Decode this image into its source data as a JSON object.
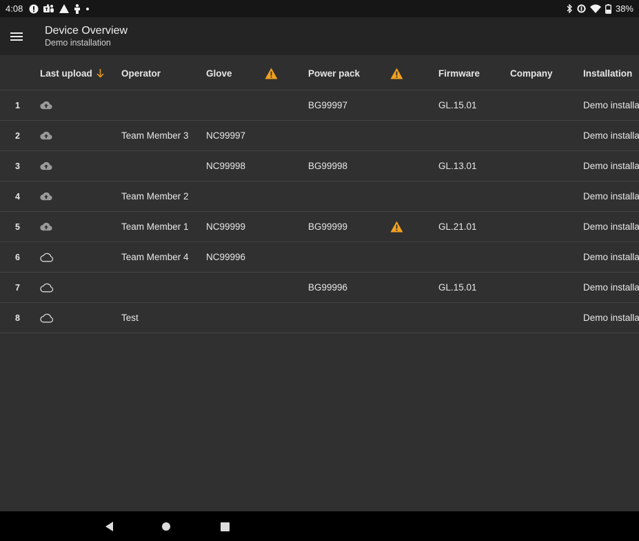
{
  "status_bar": {
    "time": "4:08",
    "battery": "38%",
    "left_icons": [
      "circle-info-icon",
      "teams-icon",
      "warning-icon",
      "person-icon",
      "dot-icon"
    ],
    "right_icons": [
      "bluetooth-icon",
      "data-saver-icon",
      "wifi-icon",
      "battery-icon"
    ]
  },
  "app_bar": {
    "title": "Device Overview",
    "subtitle": "Demo installation",
    "menu_icon": "menu-icon"
  },
  "table": {
    "headers": {
      "last_upload": "Last upload",
      "operator": "Operator",
      "glove": "Glove",
      "power_pack": "Power pack",
      "firmware": "Firmware",
      "company": "Company",
      "installation": "Installation"
    },
    "sort_icon": "arrow-down-icon",
    "rows": [
      {
        "num": "1",
        "upload": "cloud-upload-filled",
        "operator": "",
        "glove": "",
        "glove_warning": false,
        "power_pack": "BG99997",
        "power_warning": false,
        "firmware": "GL.15.01",
        "company": "",
        "installation": "Demo installat"
      },
      {
        "num": "2",
        "upload": "cloud-upload-filled",
        "operator": "Team Member 3",
        "glove": "NC99997",
        "glove_warning": false,
        "power_pack": "",
        "power_warning": false,
        "firmware": "",
        "company": "",
        "installation": "Demo installat"
      },
      {
        "num": "3",
        "upload": "cloud-upload-filled",
        "operator": "",
        "glove": "NC99998",
        "glove_warning": false,
        "power_pack": "BG99998",
        "power_warning": false,
        "firmware": "GL.13.01",
        "company": "",
        "installation": "Demo installat"
      },
      {
        "num": "4",
        "upload": "cloud-upload-filled",
        "operator": "Team Member 2",
        "glove": "",
        "glove_warning": false,
        "power_pack": "",
        "power_warning": false,
        "firmware": "",
        "company": "",
        "installation": "Demo installat"
      },
      {
        "num": "5",
        "upload": "cloud-upload-filled",
        "operator": "Team Member 1",
        "glove": "NC99999",
        "glove_warning": false,
        "power_pack": "BG99999",
        "power_warning": true,
        "firmware": "GL.21.01",
        "company": "",
        "installation": "Demo installat"
      },
      {
        "num": "6",
        "upload": "cloud-outline",
        "operator": "Team Member 4",
        "glove": "NC99996",
        "glove_warning": false,
        "power_pack": "",
        "power_warning": false,
        "firmware": "",
        "company": "",
        "installation": "Demo installat"
      },
      {
        "num": "7",
        "upload": "cloud-outline",
        "operator": "",
        "glove": "",
        "glove_warning": false,
        "power_pack": "BG99996",
        "power_warning": false,
        "firmware": "GL.15.01",
        "company": "",
        "installation": "Demo installat"
      },
      {
        "num": "8",
        "upload": "cloud-outline",
        "operator": "Test",
        "glove": "",
        "glove_warning": false,
        "power_pack": "",
        "power_warning": false,
        "firmware": "",
        "company": "",
        "installation": "Demo installat"
      }
    ]
  },
  "colors": {
    "warning": "#f0a020",
    "accent": "#f0a020",
    "background": "#303030",
    "app_bar": "#242424"
  },
  "nav_bar": {
    "icons": [
      "back-icon",
      "home-icon",
      "recents-icon"
    ]
  }
}
